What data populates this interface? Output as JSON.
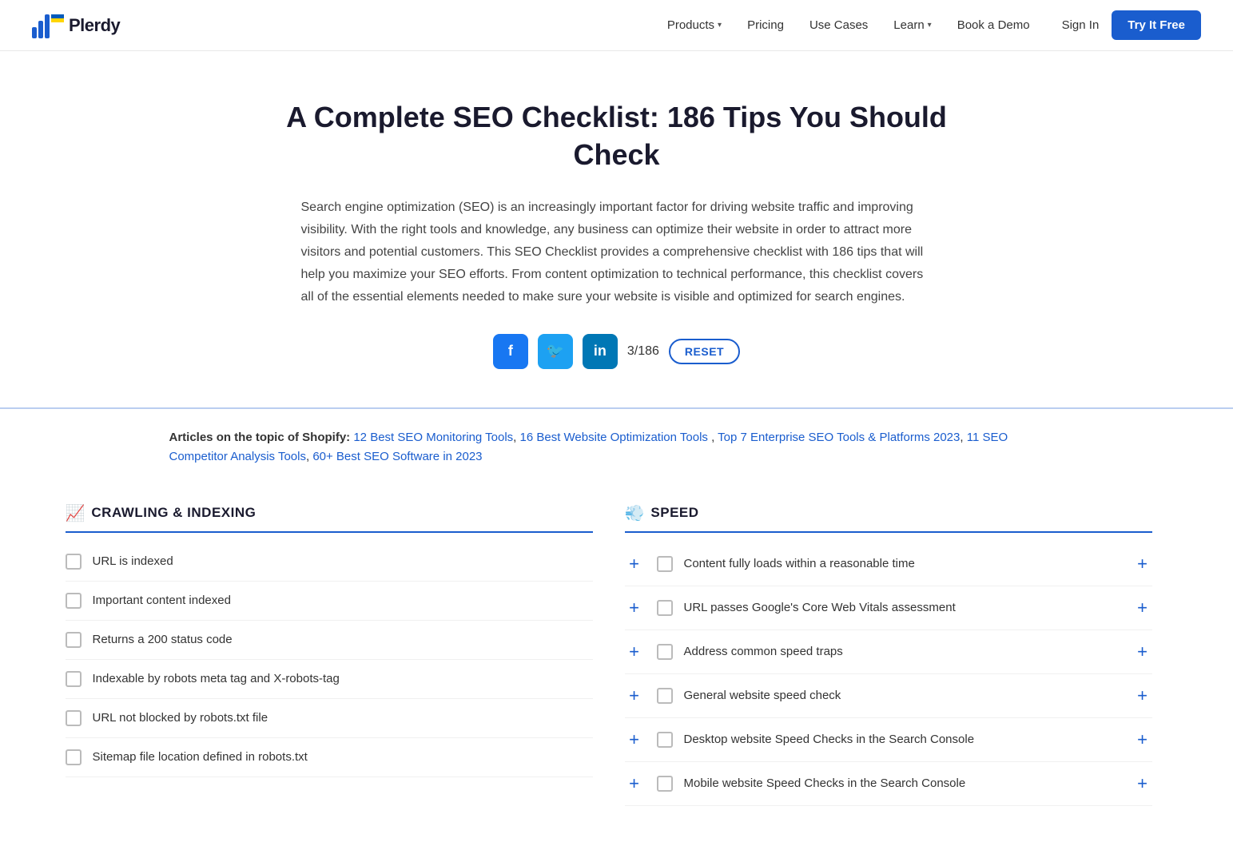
{
  "nav": {
    "logo_text": "Plerdy",
    "links": [
      {
        "label": "Products",
        "has_dropdown": true
      },
      {
        "label": "Pricing",
        "has_dropdown": false
      },
      {
        "label": "Use Cases",
        "has_dropdown": false
      },
      {
        "label": "Learn",
        "has_dropdown": true
      },
      {
        "label": "Book a Demo",
        "has_dropdown": false
      }
    ],
    "sign_in": "Sign In",
    "try_free": "Try It Free"
  },
  "hero": {
    "title": "A Complete SEO Checklist: 186 Tips You Should Check",
    "description": "Search engine optimization (SEO) is an increasingly important factor for driving website traffic and improving visibility. With the right tools and knowledge, any business can optimize their website in order to attract more visitors and potential customers. This SEO Checklist provides a comprehensive checklist with 186 tips that will help you maximize your SEO efforts. From content optimization to technical performance, this checklist covers all of the essential elements needed to make sure your website is visible and optimized for search engines.",
    "progress": "3/186",
    "reset": "RESET"
  },
  "articles": {
    "label": "Articles on the topic of Shopify:",
    "links": [
      "12 Best SEO Monitoring Tools",
      "16 Best Website Optimization Tools",
      "Top 7 Enterprise SEO Tools & Platforms 2023",
      "11 SEO Competitor Analysis Tools",
      "60+ Best SEO Software in 2023"
    ]
  },
  "sections": [
    {
      "id": "crawling",
      "icon": "📈",
      "title": "CRAWLING & INDEXING",
      "items": [
        "URL is indexed",
        "Important content indexed",
        "Returns a 200 status code",
        "Indexable by robots meta tag and X-robots-tag",
        "URL not blocked by robots.txt file",
        "Sitemap file location defined in robots.txt"
      ]
    },
    {
      "id": "speed",
      "icon": "💨",
      "title": "SPEED",
      "items": [
        "Content fully loads within a reasonable time",
        "URL passes Google's Core Web Vitals assessment",
        "Address common speed traps",
        "General website speed check",
        "Desktop website Speed Checks in the Search Console",
        "Mobile website Speed Checks in the Search Console"
      ]
    }
  ]
}
